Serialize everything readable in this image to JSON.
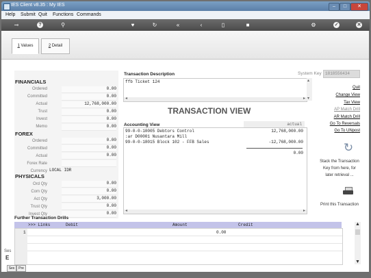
{
  "window": {
    "title": "IES Client v8.35 : My IES"
  },
  "menu": [
    "Help",
    "Submit",
    "Quit",
    "Functions",
    "Commands"
  ],
  "tabs": [
    {
      "num": "1",
      "label": " Values"
    },
    {
      "num": "2",
      "label": " Detail"
    }
  ],
  "system_key": {
    "label": "System Key",
    "value": "1818556434"
  },
  "financials": {
    "title": "FINANCIALS",
    "rows": [
      {
        "label": "Ordered",
        "value": "0.00"
      },
      {
        "label": "Committed",
        "value": "0.00"
      },
      {
        "label": "Actual",
        "value": "12,768,000.00"
      },
      {
        "label": "Trust",
        "value": "0.00"
      },
      {
        "label": "Invest",
        "value": "0.00"
      },
      {
        "label": "Memo",
        "value": "0.00"
      }
    ]
  },
  "forex": {
    "title": "FOREX",
    "rows": [
      {
        "label": "Ordered",
        "value": "0.00"
      },
      {
        "label": "Committed",
        "value": "0.00"
      },
      {
        "label": "Actual",
        "value": "0.00"
      },
      {
        "label": "Forex Rate",
        "value": ""
      },
      {
        "label": "Currency",
        "value": "LOCAL IDR"
      }
    ]
  },
  "physicals": {
    "title": "PHYSICALS",
    "rows": [
      {
        "label": "Ord Qty",
        "value": "0.00"
      },
      {
        "label": "Com Qty",
        "value": "0.00"
      },
      {
        "label": "Act Qty",
        "value": "3,000.00"
      },
      {
        "label": "Trust Qty",
        "value": "0.00"
      },
      {
        "label": "Invest Qty",
        "value": "0.00"
      }
    ]
  },
  "transaction": {
    "desc_label": "Transaction Description",
    "desc_value": "ffb Ticket 124",
    "view_title": "TRANSACTION VIEW",
    "acc_label": "Accounting View",
    "actual_col": "actual",
    "lines": [
      {
        "text": "99-0-0-10005 Debtors Control",
        "amount": "12,768,000.00"
      },
      {
        "text": " :ar  D00001 Nusantara Mill",
        "amount": ""
      },
      {
        "text": "99-0-0-18015 Block 102 - FFB Sales",
        "amount": "-12,768,000.00"
      }
    ],
    "total": "0.00"
  },
  "links": [
    {
      "label": "Quit",
      "enabled": true
    },
    {
      "label": "Change View",
      "enabled": true
    },
    {
      "label": "Tax View",
      "enabled": true
    },
    {
      "label": "AP Match Drill",
      "enabled": false
    },
    {
      "label": "AR Match Drill",
      "enabled": true
    },
    {
      "label": "Go To Reversals",
      "enabled": true
    },
    {
      "label": "Go To UNpost",
      "enabled": true
    }
  ],
  "stack_text": [
    "Stack the Transaction",
    "Key from here, for",
    "later retrieval ..."
  ],
  "print_text": "Print this Transaction",
  "drills": {
    "title": "Further Transaction Drills",
    "columns": [
      ">>> Links",
      "Debit",
      "Amount",
      "Credit"
    ],
    "rows": [
      {
        "num": "1",
        "amount": "0.00"
      }
    ]
  },
  "bottom_tabs": [
    "Ses",
    "Pre"
  ],
  "side_letters": [
    "Ses",
    "E"
  ]
}
